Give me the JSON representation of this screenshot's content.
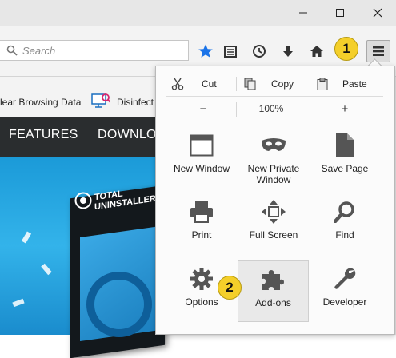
{
  "window": {
    "minimize_icon": "minimize-icon",
    "maximize_icon": "maximize-icon",
    "close_icon": "close-icon"
  },
  "navbar": {
    "search": {
      "placeholder": "Search",
      "value": ""
    },
    "toolbar_icons": [
      "star-icon",
      "reading-list-icon",
      "history-icon",
      "download-icon",
      "home-icon",
      "hamburger-menu-icon"
    ],
    "star_color": "#1a73e8"
  },
  "bookmarks": [
    {
      "label": "lear Browsing Data"
    },
    {
      "label": "Disinfect"
    }
  ],
  "site": {
    "nav": [
      "FEATURES",
      "DOWNLO"
    ],
    "product_title_line1": "TOTAL",
    "product_title_line2": "UNINSTALLER",
    "hero_color": "#22a3e0"
  },
  "menu": {
    "edit": {
      "cut": "Cut",
      "copy": "Copy",
      "paste": "Paste"
    },
    "zoom": {
      "minus": "−",
      "value": "100%",
      "plus": "+"
    },
    "items": [
      {
        "label": "New Window",
        "icon": "new-window-icon"
      },
      {
        "label": "New Private Window",
        "icon": "private-mask-icon"
      },
      {
        "label": "Save Page",
        "icon": "save-page-icon"
      },
      {
        "label": "Print",
        "icon": "printer-icon"
      },
      {
        "label": "Full Screen",
        "icon": "full-screen-icon"
      },
      {
        "label": "Find",
        "icon": "magnifier-icon"
      },
      {
        "label": "Options",
        "icon": "gear-icon"
      },
      {
        "label": "Add-ons",
        "icon": "puzzle-icon",
        "highlighted": true
      },
      {
        "label": "Developer",
        "icon": "wrench-icon"
      }
    ]
  },
  "callouts": {
    "first": "1",
    "second": "2",
    "color": "#f4cf2a"
  }
}
